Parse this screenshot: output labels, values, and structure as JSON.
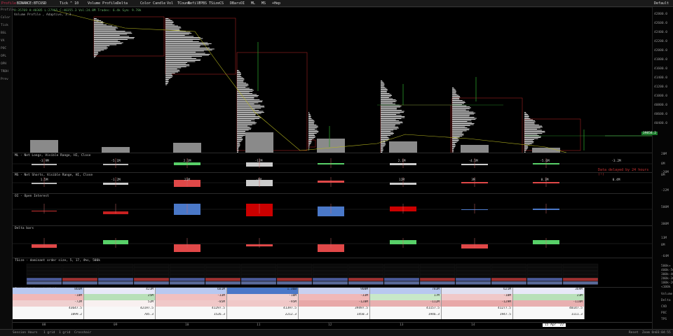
{
  "toolbar": {
    "profile": "Profile",
    "symbol": "BINANCE:BTCUSD",
    "tick": "Tick ^ 10",
    "tool": "Volume Profile",
    "delta": "Delta",
    "color": "Color Candle",
    "items": [
      "Vol",
      "TCount",
      "Refill",
      "FPBS",
      "TSize",
      "CS",
      "DBars",
      "OI",
      "ML",
      "MS",
      "+Hep"
    ],
    "default": "Default"
  },
  "sidebar": [
    "Profile",
    "Color",
    "Tick",
    "BGL",
    "VA",
    "POC",
    "OPL",
    "OPH",
    "TRDH",
    "Prev"
  ],
  "main": {
    "info1": "O:35769 H:40305 L:27965 C:40355.3 Vol:24.8M Trades: 6.4k Sym: 9.78k",
    "info2": "Volume Profile , Adaptive, 3.3",
    "price_tag": "39858.2",
    "watermark": "",
    "price_ticks": [
      "42800.0",
      "42600.0",
      "42400.0",
      "42200.0",
      "42000.0",
      "41800.0",
      "41600.0",
      "41400.0",
      "41200.0",
      "41000.0",
      "40800.0",
      "40600.0",
      "40400.0"
    ]
  },
  "panes": [
    {
      "title": "ML - Net Longs, Visible Range, HI, Close",
      "delayed": "Data delayed by 24 hours (!)",
      "ticks": [
        "20M",
        "0M",
        "-20M"
      ],
      "labels": [
        "-3.9M",
        "-5.1M",
        "2.1M",
        "-12M",
        "",
        "2.1M",
        "-4.5M",
        "-5.6M",
        "-3.2M"
      ]
    },
    {
      "title": "MS - Net Shorts, Visible Range, HI, Close",
      "ticks": [
        "0M",
        "-22M"
      ],
      "labels": [
        "1.5M",
        "-1.2M",
        "21M",
        "-6M",
        "",
        "12M",
        "3M",
        "0.3M",
        "0.4M"
      ]
    },
    {
      "title": "OI - Open Interest",
      "ticks": [
        "500M",
        "300M"
      ]
    },
    {
      "title": "Delta bars",
      "ticks": [
        "13M",
        "0M",
        "-64M"
      ]
    },
    {
      "title": "TSize - dominant order size, 5, 17, 4%s, 500k",
      "ticks": [
        "500k+",
        "400k-500k",
        "300k-400k",
        "200k-300k",
        "100k-200k",
        "<100k"
      ]
    },
    {
      "title": "Footprint bar statistics",
      "rowlabels": [
        "Volume",
        "Delta",
        "CVD",
        "POC",
        "TPS"
      ]
    }
  ],
  "footprint": {
    "rows": [
      [
        "866M",
        "423M",
        "681M",
        "1.36B",
        "908M",
        "783M",
        "621M",
        "369M"
      ],
      [
        "-18M",
        "25M",
        "-33M",
        "-10M",
        "-33M",
        "17M",
        "-18M",
        "23M"
      ],
      [
        "-72M",
        "52M",
        "-85M",
        "-95M",
        "-128M",
        "-112M",
        "-129M",
        "-114M"
      ],
      [
        "43647.5",
        "42197.5",
        "41297.5",
        "41397.5",
        "39497.5",
        "41157.5",
        "41277.5",
        "40147.5"
      ],
      [
        "1899.2",
        "705.3",
        "1526.3",
        "2212.3",
        "1450.3",
        "1946.3",
        "1947.5",
        "1111.3"
      ]
    ]
  },
  "xaxis": {
    "labels": [
      "08",
      "09",
      "10",
      "11",
      "12",
      "13",
      "14",
      "15 Apr '22"
    ]
  },
  "bottom": {
    "items": [
      "Session",
      "Hours",
      "1 grid",
      "1 grid",
      "Crosshair"
    ],
    "right": [
      "Reset",
      "Zoom On",
      "03:04:55"
    ]
  }
}
